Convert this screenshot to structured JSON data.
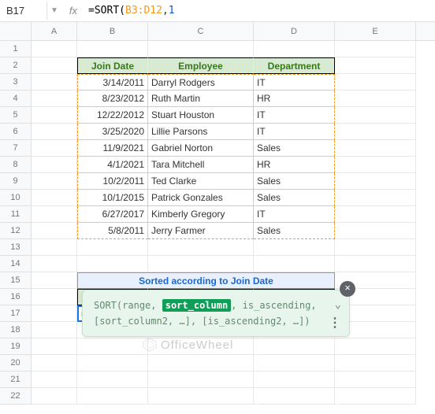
{
  "formula_bar": {
    "cell_ref": "B17",
    "fx": "fx",
    "formula_prefix": "=SORT(",
    "formula_range": "B3:D12",
    "formula_sep": ",",
    "formula_arg": "1"
  },
  "columns": [
    "A",
    "B",
    "C",
    "D",
    "E"
  ],
  "rows": [
    "1",
    "2",
    "3",
    "4",
    "5",
    "6",
    "7",
    "8",
    "9",
    "10",
    "11",
    "12",
    "13",
    "14",
    "15",
    "16",
    "17",
    "18",
    "19",
    "20",
    "21",
    "22"
  ],
  "headers": {
    "b": "Join Date",
    "c": "Employee",
    "d": "Department"
  },
  "chart_data": {
    "type": "table",
    "columns": [
      "Join Date",
      "Employee",
      "Department"
    ],
    "rows": [
      {
        "date": "3/14/2011",
        "employee": "Darryl Rodgers",
        "department": "IT"
      },
      {
        "date": "8/23/2012",
        "employee": "Ruth Martin",
        "department": "HR"
      },
      {
        "date": "12/22/2012",
        "employee": "Stuart Houston",
        "department": "IT"
      },
      {
        "date": "3/25/2020",
        "employee": "Lillie Parsons",
        "department": "IT"
      },
      {
        "date": "11/9/2021",
        "employee": "Gabriel Norton",
        "department": "Sales"
      },
      {
        "date": "4/1/2021",
        "employee": "Tara Mitchell",
        "department": "HR"
      },
      {
        "date": "10/2/2011",
        "employee": "Ted Clarke",
        "department": "Sales"
      },
      {
        "date": "10/1/2015",
        "employee": "Patrick Gonzales",
        "department": "Sales"
      },
      {
        "date": "6/27/2017",
        "employee": "Kimberly Gregory",
        "department": "IT"
      },
      {
        "date": "5/8/2011",
        "employee": "Jerry Farmer",
        "department": "Sales"
      }
    ]
  },
  "sorted_title": "Sorted according to Join Date",
  "active_cell": {
    "prefix": "=SORT(",
    "range": "B3:D12",
    "sep": ",",
    "arg": "1"
  },
  "tooltip": {
    "fn": "SORT",
    "open": "(",
    "arg1": "range",
    "sep1": ", ",
    "arg2": "sort_column",
    "sep2": ", ",
    "arg3": "is_ascending",
    "sep3": ",",
    "line2": "[sort_column2, …], [is_ascending2, …])",
    "close_x": "×",
    "dots": "⋮"
  },
  "watermark": "OfficeWheel"
}
